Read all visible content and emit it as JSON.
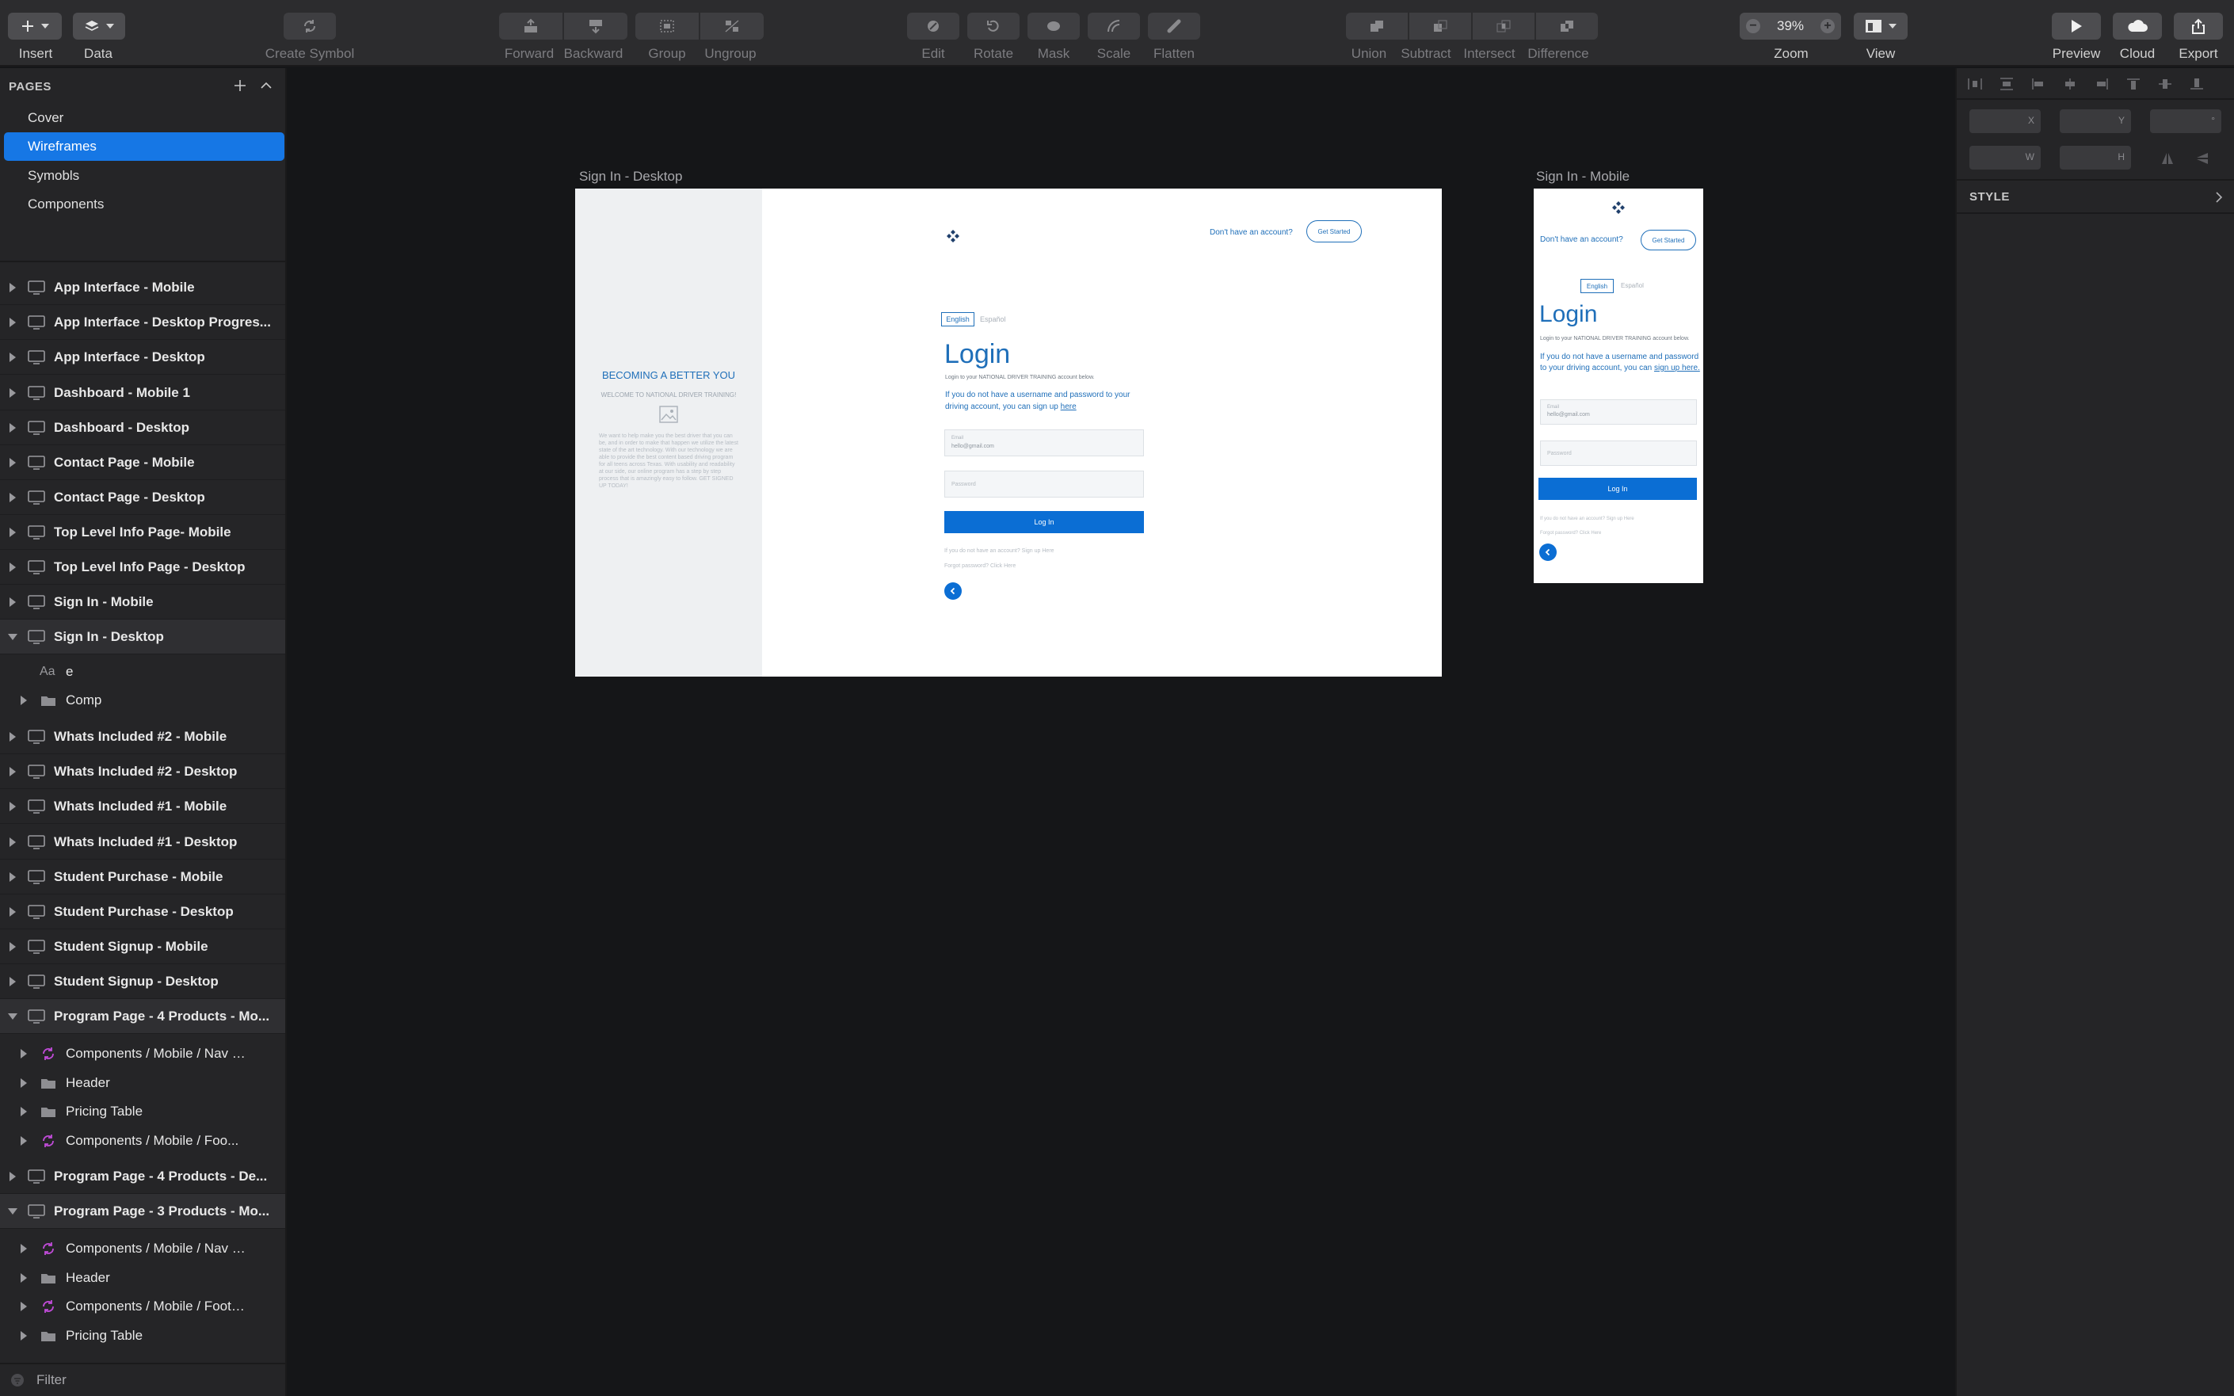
{
  "toolbar": {
    "insert": "Insert",
    "data": "Data",
    "create_symbol": "Create Symbol",
    "forward": "Forward",
    "backward": "Backward",
    "group": "Group",
    "ungroup": "Ungroup",
    "edit": "Edit",
    "rotate": "Rotate",
    "mask": "Mask",
    "scale": "Scale",
    "flatten": "Flatten",
    "union": "Union",
    "subtract": "Subtract",
    "intersect": "Intersect",
    "difference": "Difference",
    "zoom_value": "39%",
    "zoom_label": "Zoom",
    "view": "View",
    "preview": "Preview",
    "cloud": "Cloud",
    "export": "Export"
  },
  "sidebar": {
    "pages_header": "PAGES",
    "pages": [
      {
        "label": "Cover"
      },
      {
        "label": "Wireframes",
        "active": true
      },
      {
        "label": "Symobls"
      },
      {
        "label": "Components"
      }
    ],
    "layers": [
      "App Interface - Mobile",
      "App Interface - Desktop Progres...",
      "App Interface - Desktop",
      "Dashboard - Mobile 1",
      "Dashboard - Desktop",
      "Contact Page - Mobile",
      "Contact Page - Desktop",
      "Top Level Info Page- Mobile",
      "Top Level Info Page - Desktop",
      "Sign In - Mobile",
      "Sign In - Desktop",
      "e",
      "Comp",
      "Whats Included #2 - Mobile",
      "Whats Included #2 - Desktop",
      "Whats Included #1 - Mobile",
      "Whats Included #1 - Desktop",
      "Student Purchase - Mobile",
      "Student Purchase - Desktop",
      "Student Signup - Mobile",
      "Student Signup - Desktop",
      "Program Page -  4 Products - Mo...",
      "Components / Mobile / Nav / To...",
      "Header",
      "Pricing Table",
      "Components / Mobile / Foo...",
      "Program Page -  4 Products - De...",
      "Program Page - 3 Products - Mo...",
      "Components / Mobile / Nav / To...",
      "Header",
      "Components / Mobile / Footer /...",
      "Pricing Table"
    ],
    "text_layer_glyph": "Aa",
    "filter": "Filter"
  },
  "canvas": {
    "desktop_title": "Sign In - Desktop",
    "mobile_title": "Sign In - Mobile",
    "desktop": {
      "side_heading": "BECOMING A BETTER YOU",
      "side_sub": "WELCOME TO NATIONAL DRIVER TRAINING!",
      "side_desc": "We want to help make you the best driver that you can be, and in order to make that happen we utilize the latest state of the art technology. With our technology we are able to provide the best content based driving program for all teens across Texas. With usability and readability at our side, our online program has a step by step process that is amazingly easy to follow. GET SIGNED UP TODAY!",
      "no_account": "Don't have an account?",
      "get_started": "Get Started",
      "lang_en": "English",
      "lang_es": "Español",
      "title": "Login",
      "subtitle": "Login to your NATIONAL DRIVER TRAINING account below.",
      "info_text": "If you do not have a username and password to your driving account, you can sign up",
      "info_link": "here",
      "email_label": "Email",
      "email_value": "hello@gmail.com",
      "password_placeholder": "Password",
      "login_button": "Log In",
      "signup_hint": "If you do not have an account? Sign up Here",
      "forgot": "Forgot password? Click Here"
    },
    "mobile": {
      "no_account": "Don't have an account?",
      "get_started": "Get Started",
      "lang_en": "English",
      "lang_es": "Español",
      "title": "Login",
      "subtitle": "Login to your NATIONAL DRIVER TRAINING account below.",
      "info_text": "If you do not have a username and password to your driving account, you can",
      "info_link": "sign up here.",
      "email_label": "Email",
      "email_value": "hello@gmail.com",
      "password_placeholder": "Password",
      "login_button": "Log In",
      "signup_hint": "If you do not have an account? Sign up Here",
      "forgot": "Forgot password? Click Here"
    }
  },
  "inspector": {
    "x": "X",
    "y": "Y",
    "w": "W",
    "h": "H",
    "degree": "°",
    "style": "STYLE"
  },
  "colors": {
    "accent": "#1677e5",
    "brand_blue": "#1f6fb9",
    "button_blue": "#0b6ed4"
  }
}
